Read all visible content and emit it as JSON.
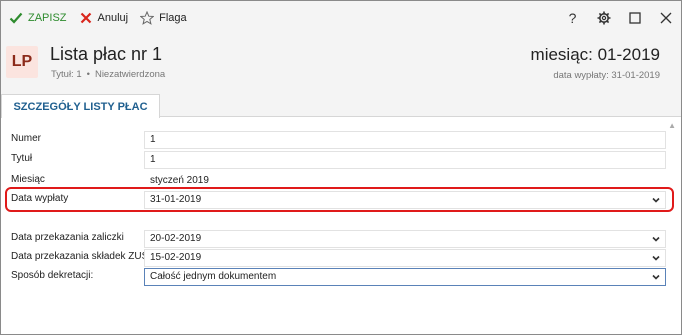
{
  "toolbar": {
    "save_label": "ZAPISZ",
    "cancel_label": "Anuluj",
    "flag_label": "Flaga"
  },
  "window_controls": [
    "help",
    "settings",
    "maximize",
    "close"
  ],
  "header": {
    "badge": "LP",
    "title": "Lista płac nr 1",
    "subtitle_left": "Tytuł: 1",
    "subtitle_right": "Niezatwierdzona",
    "month": "miesiąc: 01-2019",
    "pay_date": "data wypłaty: 31-01-2019"
  },
  "tab": {
    "label": "SZCZEGÓŁY LISTY PŁAC"
  },
  "form": {
    "numer": {
      "label": "Numer",
      "value": "1"
    },
    "tytul": {
      "label": "Tytuł",
      "value": "1"
    },
    "miesiac": {
      "label": "Miesiąc",
      "value": "styczeń 2019"
    },
    "data_wyplaty": {
      "label": "Data wypłaty",
      "value": "31-01-2019"
    },
    "data_zaliczki": {
      "label": "Data przekazania zaliczki",
      "value": "20-02-2019"
    },
    "data_zus": {
      "label": "Data przekazania składek ZUS",
      "value": "15-02-2019"
    },
    "dekretacja": {
      "label": "Sposób dekretacji:",
      "value": "Całość jednym dokumentem"
    }
  },
  "colors": {
    "accent": "#1f5f8f",
    "save_green": "#2e8b2e",
    "cancel_red": "#d9261c",
    "badge_bg": "#fbe4df",
    "badge_fg": "#8c2a1a",
    "highlight": "#e01a1a"
  },
  "icons": {
    "save": "check-icon",
    "cancel": "x-icon",
    "flag": "star-icon",
    "help": "question-icon",
    "settings": "gear-icon",
    "maximize": "square-icon",
    "close": "close-icon",
    "dropdown": "chevron-down-icon"
  }
}
